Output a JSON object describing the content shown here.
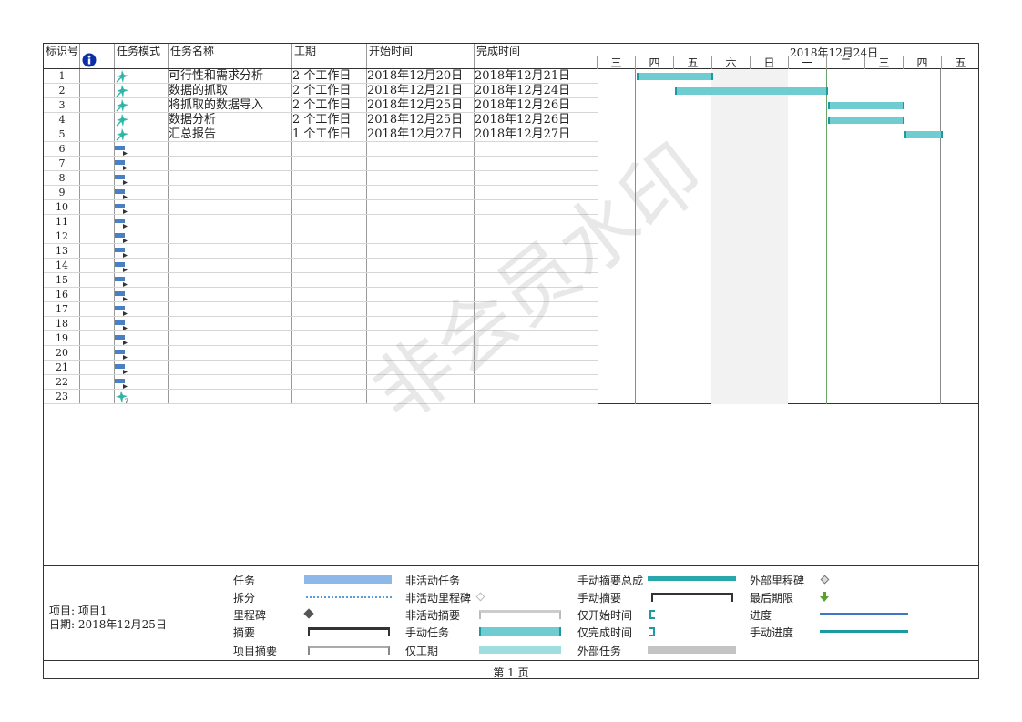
{
  "table": {
    "headers": {
      "id": "标识号",
      "mode": "任务模式",
      "name": "任务名称",
      "duration": "工期",
      "start": "开始时间",
      "finish": "完成时间"
    },
    "tasks": [
      {
        "id": "1",
        "name": "可行性和需求分析",
        "duration": "2 个工作日",
        "start": "2018年12月20日",
        "finish": "2018年12月21日"
      },
      {
        "id": "2",
        "name": "数据的抓取",
        "duration": "2 个工作日",
        "start": "2018年12月21日",
        "finish": "2018年12月24日"
      },
      {
        "id": "3",
        "name": "将抓取的数据导入",
        "duration": "2 个工作日",
        "start": "2018年12月25日",
        "finish": "2018年12月26日"
      },
      {
        "id": "4",
        "name": "数据分析",
        "duration": "2 个工作日",
        "start": "2018年12月25日",
        "finish": "2018年12月26日"
      },
      {
        "id": "5",
        "name": "汇总报告",
        "duration": "1 个工作日",
        "start": "2018年12月27日",
        "finish": "2018年12月27日"
      }
    ],
    "empty_ids": [
      "6",
      "7",
      "8",
      "9",
      "10",
      "11",
      "12",
      "13",
      "14",
      "15",
      "16",
      "17",
      "18",
      "19",
      "20",
      "21",
      "22",
      "23"
    ]
  },
  "gantt": {
    "week_label": "2018年12月24日",
    "days": [
      "三",
      "四",
      "五",
      "六",
      "日",
      "一",
      "二",
      "三",
      "四",
      "五"
    ],
    "bar_color": "#6fcdd1"
  },
  "watermark": "非会员水印",
  "legend": {
    "project_label": "项目: 项目1",
    "date_label": "日期: 2018年12月25日",
    "items": {
      "task": "任务",
      "split": "拆分",
      "milestone": "里程碑",
      "summary": "摘要",
      "project_summary": "项目摘要",
      "inactive_task": "非活动任务",
      "inactive_milestone": "非活动里程碑",
      "inactive_summary": "非活动摘要",
      "manual_task": "手动任务",
      "duration_only": "仅工期",
      "manual_summary_rollup": "手动摘要总成",
      "manual_summary": "手动摘要",
      "start_only": "仅开始时间",
      "finish_only": "仅完成时间",
      "external_tasks": "外部任务",
      "external_milestone": "外部里程碑",
      "deadline": "最后期限",
      "progress": "进度",
      "manual_progress": "手动进度"
    }
  },
  "footer": "第 1 页"
}
